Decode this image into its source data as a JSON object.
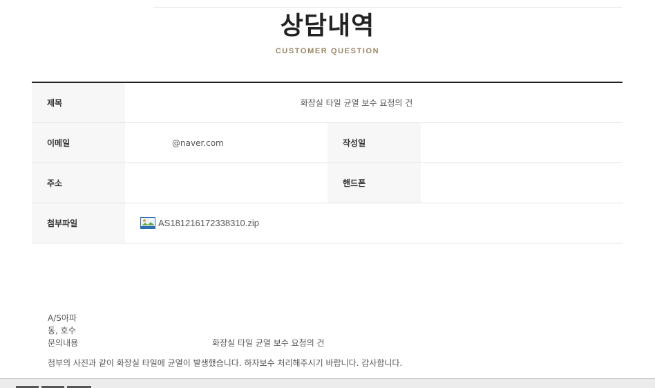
{
  "header": {
    "title": "상담내역",
    "subtitle": "CUSTOMER QUESTION"
  },
  "info": {
    "subject_label": "제목",
    "subject_value": "화장실 타일 균열 보수 요청의 건",
    "email_label": "이메일",
    "email_value": "@naver.com",
    "date_label": "작성일",
    "date_value": "",
    "address_label": "주소",
    "address_value": "",
    "phone_label": "핸드폰",
    "phone_value": "",
    "attachment_label": "첨부파일",
    "attachment_name": "AS181216172338310.zip",
    "attachment_icon": "image-file-icon"
  },
  "content": {
    "line1": "A/S아파",
    "line2": "동, 호수",
    "inquiry_label": "문의내용",
    "inquiry_value": "화장실 타일 균열 보수 요청의 건",
    "message": "첨부의 사진과 같이 화장실 타일에 균열이 발생했습니다. 하자보수 처리해주시기 바랍니다. 감사합니다."
  }
}
